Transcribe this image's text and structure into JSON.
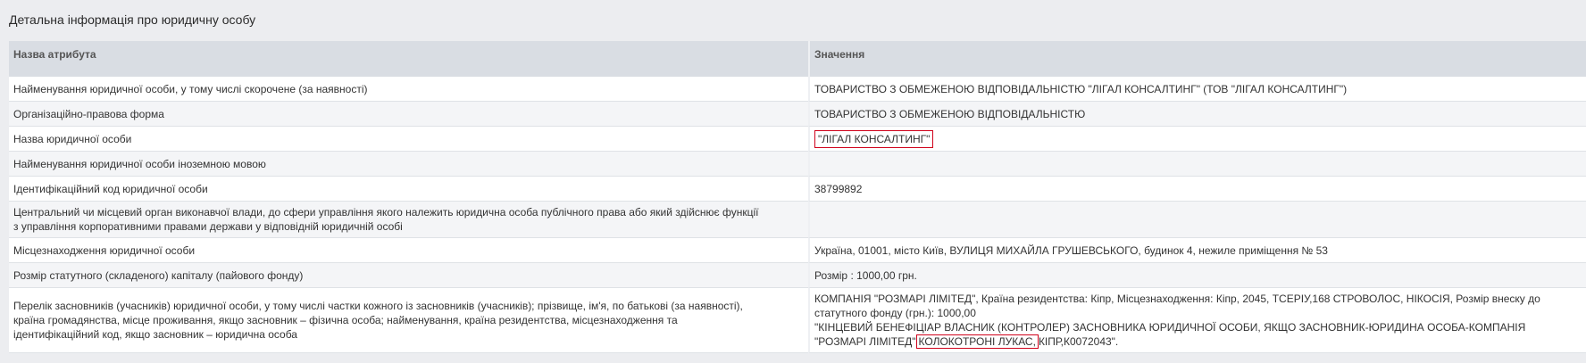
{
  "page_title": "Детальна інформація про юридичну особу",
  "table": {
    "header": {
      "attribute": "Назва атрибута",
      "value": "Значення"
    },
    "rows": [
      {
        "label": "Найменування юридичної особи, у тому числі скорочене (за наявності)",
        "value": "ТОВАРИСТВО З ОБМЕЖЕНОЮ ВІДПОВІДАЛЬНІСТЮ \"ЛІГАЛ КОНСАЛТИНГ\" (ТОВ \"ЛІГАЛ КОНСАЛТИНГ\")"
      },
      {
        "label": "Організаційно-правова форма",
        "value": "ТОВАРИСТВО З ОБМЕЖЕНОЮ ВІДПОВІДАЛЬНІСТЮ"
      },
      {
        "label": "Назва юридичної особи",
        "value": "\"ЛІГАЛ КОНСАЛТИНГ\""
      },
      {
        "label": "Найменування юридичної особи іноземною мовою",
        "value": ""
      },
      {
        "label": "Ідентифікаційний код юридичної особи",
        "value": "38799892"
      },
      {
        "label_line1": "Центральний чи місцевий орган виконавчої влади, до сфери управління якого належить юридична особа публічного права або який здійснює функції",
        "label_line2": "з управління корпоративними правами держави у відповідній юридичній особі",
        "value": ""
      },
      {
        "label": "Місцезнаходження юридичної особи",
        "value": "Україна, 01001, місто Київ, ВУЛИЦЯ МИХАЙЛА ГРУШЕВСЬКОГО, будинок 4, нежиле приміщення № 53"
      },
      {
        "label": "Розмір статутного (складеного) капіталу (пайового фонду)",
        "value": "Розмір : 1000,00 грн."
      },
      {
        "label_line1": "Перелік засновників (учасників) юридичної особи, у тому числі частки кожного із засновників (учасників); прізвище, ім'я, по батькові (за наявності),",
        "label_line2": "країна громадянства, місце проживання, якщо засновник – фізична особа; найменування, країна резидентства, місцезнаходження та",
        "label_line3": "ідентифікаційний код, якщо засновник – юридична особа",
        "value_line1": "КОМПАНІЯ \"РОЗМАРІ ЛІМІТЕД\", Країна резидентства: Кіпр, Місцезнаходження: Кіпр, 2045, ТСЕРІУ,168 СТРОВОЛОС, НІКОСІЯ, Розмір внеску до",
        "value_line2": "статутного фонду (грн.): 1000,00",
        "value_line3": "\"КІНЦЕВИЙ БЕНЕФІЦІАР ВЛАСНИК (КОНТРОЛЕР) ЗАСНОВНИКА ЮРИДИЧНОЇ ОСОБИ, ЯКЩО ЗАСНОВНИК-ЮРИДИНА ОСОБА-КОМПАНІЯ",
        "value_line4_prefix": "\"РОЗМАРІ ЛІМІТЕД\"",
        "value_line4_highlight": "КОЛОКОТРОНІ ЛУКАС,",
        "value_line4_suffix": "КІПР,К0072043\"."
      }
    ]
  }
}
